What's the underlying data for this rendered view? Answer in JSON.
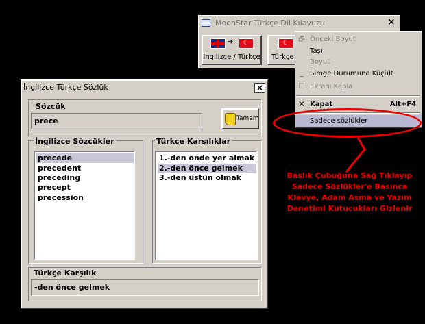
{
  "moonstar_window": {
    "title": "MoonStar Türkçe Dil Kılavuzu",
    "close_glyph": "×",
    "buttons": [
      {
        "label": "İngilizce / Türkçe",
        "icons": [
          "uk-flag-icon",
          "arrow-right-icon",
          "turkey-flag-icon"
        ]
      },
      {
        "label": "Türkçe",
        "icons": [
          "turkey-flag-icon"
        ]
      }
    ]
  },
  "context_menu": {
    "items": [
      {
        "label": "Önceki Boyut",
        "icon": "restore-icon",
        "enabled": false
      },
      {
        "label": "Taşı",
        "enabled": true
      },
      {
        "label": "Boyut",
        "enabled": false
      },
      {
        "label": "Simge Durumuna Küçült",
        "icon": "minimize-icon",
        "enabled": true
      },
      {
        "label": "Ekranı Kapla",
        "icon": "maximize-icon",
        "enabled": false
      },
      {
        "label": "Kapat",
        "shortcut": "Alt+F4",
        "icon": "close-icon",
        "enabled": true,
        "bold": true
      },
      {
        "label": "Sadece sözlükler",
        "enabled": true,
        "highlighted": true
      }
    ]
  },
  "dialog": {
    "title": "İngilizce Türkçe Sözlük",
    "close_glyph": "×",
    "word_label": "Sözcük",
    "word_value": "prece",
    "ok_button": "Tamam",
    "english_label": "İngilizce Sözcükler",
    "english_words": [
      "precede",
      "precedent",
      "preceding",
      "precept",
      "precession"
    ],
    "english_selected_index": 0,
    "turkish_label": "Türkçe Karşılıklar",
    "turkish_meanings": [
      "1.-den önde yer almak",
      "2.-den önce gelmek",
      "3.-den üstün olmak"
    ],
    "turkish_selected_index": 1,
    "result_label": "Türkçe Karşılık",
    "result_value": "-den önce gelmek"
  },
  "annotation": {
    "color": "#e00000",
    "lines": [
      "Başlık Çubuğuna Sağ Tıklayıp",
      "Sadece Sözlükler'e Basınca",
      "Klavye, Adam Asma ve Yazım",
      "Denetimi Kutucukları Gizlenir"
    ]
  }
}
